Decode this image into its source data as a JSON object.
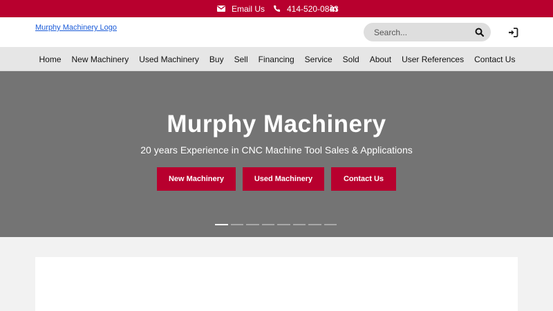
{
  "topbar": {
    "email_label": "Email Us",
    "phone": "414-520-0843",
    "linkedin_label": "in",
    "icons": [
      "envelope-icon",
      "phone-icon",
      "linkedin-icon"
    ]
  },
  "header": {
    "logo_text": "Murphy Machinery Logo",
    "search_placeholder": "Search...",
    "icons": [
      "search-icon",
      "sign-in-icon"
    ]
  },
  "nav": {
    "items": [
      {
        "label": "Home"
      },
      {
        "label": "New Machinery"
      },
      {
        "label": "Used Machinery"
      },
      {
        "label": "Buy"
      },
      {
        "label": "Sell"
      },
      {
        "label": "Financing"
      },
      {
        "label": "Service"
      },
      {
        "label": "Sold"
      },
      {
        "label": "About"
      },
      {
        "label": "User References"
      },
      {
        "label": "Contact Us"
      }
    ]
  },
  "hero": {
    "title": "Murphy Machinery",
    "subtitle": "20 years Experience in CNC Machine Tool Sales & Applications",
    "buttons": [
      "New Machinery",
      "Used Machinery",
      "Contact Us"
    ],
    "slide_count": 8,
    "active_slide": 1
  },
  "colors": {
    "brand_red": "#b8002e",
    "hero_gray": "#747474",
    "nav_bg": "#e6e6e6"
  }
}
